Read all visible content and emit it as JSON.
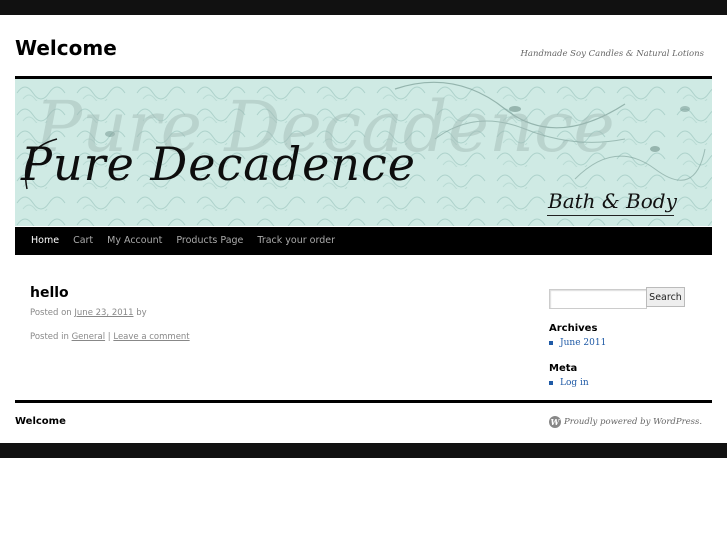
{
  "site": {
    "title": "Welcome",
    "tagline": "Handmade Soy Candles & Natural Lotions"
  },
  "banner": {
    "title": "Pure Decadence",
    "subtitle": "Bath & Body",
    "watermark": "Pure Decadence",
    "background_color": "#cfeae4"
  },
  "nav": {
    "items": [
      {
        "label": "Home",
        "current": true
      },
      {
        "label": "Cart"
      },
      {
        "label": "My Account"
      },
      {
        "label": "Products Page"
      },
      {
        "label": "Track your order"
      }
    ]
  },
  "post": {
    "title": "hello",
    "posted_on_label": "Posted on",
    "date": "June 23, 2011",
    "by_label": "by",
    "posted_in_label": "Posted in",
    "category": "General",
    "separator": "|",
    "comment_link": "Leave a comment"
  },
  "sidebar": {
    "search_button": "Search",
    "search_value": "",
    "archives_title": "Archives",
    "archives": [
      "June 2011"
    ],
    "meta_title": "Meta",
    "meta": [
      "Log in"
    ]
  },
  "footer": {
    "title": "Welcome",
    "powered_by": "Proudly powered by WordPress."
  },
  "colors": {
    "link": "#1f5aa6",
    "bar": "#111111",
    "nav_bg": "#000000"
  }
}
